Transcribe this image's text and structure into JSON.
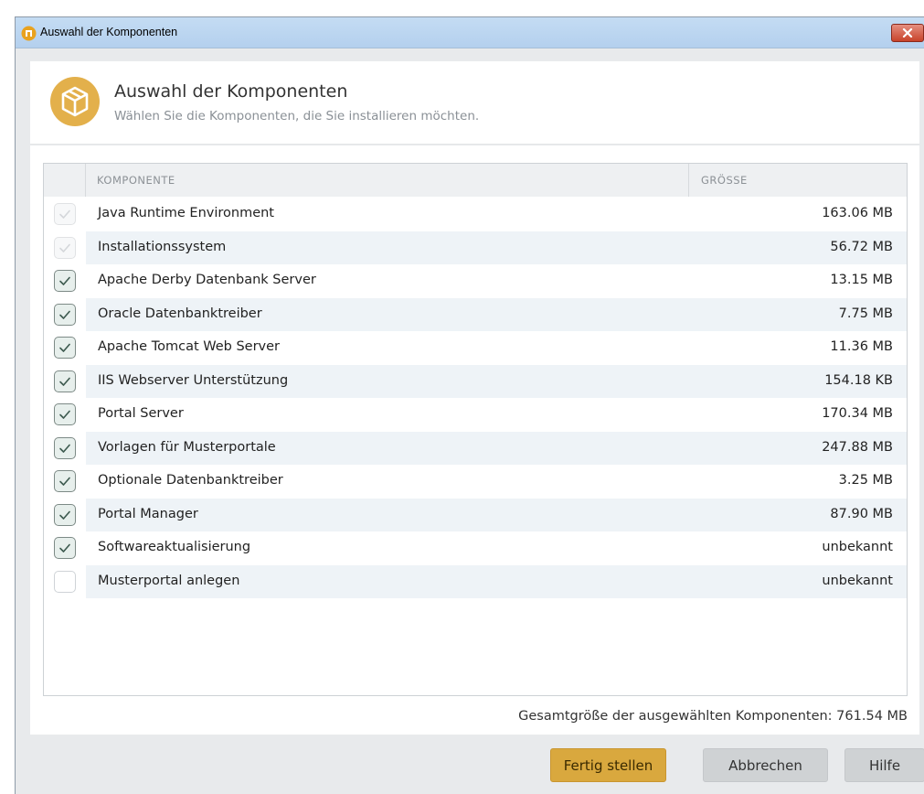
{
  "window": {
    "title": "Auswahl der Komponenten"
  },
  "header": {
    "title": "Auswahl der Komponenten",
    "subtitle": "Wählen Sie die Komponenten, die Sie installieren möchten.",
    "icon": "package-box-icon"
  },
  "table": {
    "columns": {
      "name": "KOMPONENTE",
      "size": "GRÖSSE"
    },
    "rows": [
      {
        "name": "Java Runtime Environment",
        "size": "163.06 MB",
        "checked": true,
        "disabled": true
      },
      {
        "name": "Installationssystem",
        "size": "56.72 MB",
        "checked": true,
        "disabled": true
      },
      {
        "name": "Apache Derby Datenbank Server",
        "size": "13.15 MB",
        "checked": true,
        "disabled": false
      },
      {
        "name": "Oracle Datenbanktreiber",
        "size": "7.75 MB",
        "checked": true,
        "disabled": false
      },
      {
        "name": "Apache Tomcat Web Server",
        "size": "11.36 MB",
        "checked": true,
        "disabled": false
      },
      {
        "name": "IIS Webserver Unterstützung",
        "size": "154.18 KB",
        "checked": true,
        "disabled": false
      },
      {
        "name": "Portal Server",
        "size": "170.34 MB",
        "checked": true,
        "disabled": false
      },
      {
        "name": "Vorlagen für Musterportale",
        "size": "247.88 MB",
        "checked": true,
        "disabled": false
      },
      {
        "name": "Optionale Datenbanktreiber",
        "size": "3.25 MB",
        "checked": true,
        "disabled": false
      },
      {
        "name": "Portal Manager",
        "size": "87.90 MB",
        "checked": true,
        "disabled": false
      },
      {
        "name": "Softwareaktualisierung",
        "size": "unbekannt",
        "checked": true,
        "disabled": false
      },
      {
        "name": "Musterportal anlegen",
        "size": "unbekannt",
        "checked": false,
        "disabled": false
      }
    ]
  },
  "total": {
    "label": "Gesamtgröße der ausgewählten Komponenten: 761.54 MB"
  },
  "buttons": {
    "finish": "Fertig stellen",
    "cancel": "Abbrechen",
    "help": "Hilfe"
  },
  "colors": {
    "accent": "#d9a83e",
    "titlebar": "#c4dcf3",
    "row_alt": "#eef3f7"
  }
}
